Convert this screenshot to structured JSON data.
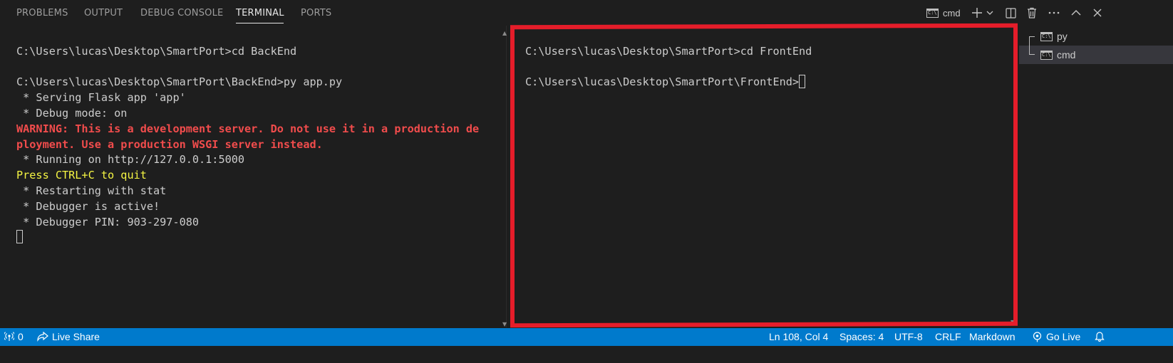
{
  "panel_tabs": [
    "PROBLEMS",
    "OUTPUT",
    "DEBUG CONSOLE",
    "TERMINAL",
    "PORTS"
  ],
  "active_tab": "TERMINAL",
  "toolbar": {
    "terminal_name": "cmd",
    "icons": [
      "cmd-icon",
      "plus-icon",
      "chevron-down-icon",
      "split-icon",
      "trash-icon",
      "more-icon",
      "chevron-up-icon",
      "close-icon"
    ]
  },
  "left_terminal": {
    "lines": [
      "",
      "C:\\Users\\lucas\\Desktop\\SmartPort>cd BackEnd",
      "",
      "C:\\Users\\lucas\\Desktop\\SmartPort\\BackEnd>py app.py",
      " * Serving Flask app 'app'",
      " * Debug mode: on",
      "WARNING: This is a development server. Do not use it in a production de",
      "ployment. Use a production WSGI server instead.",
      " * Running on http://127.0.0.1:5000",
      "Press CTRL+C to quit",
      " * Restarting with stat",
      " * Debugger is active!",
      " * Debugger PIN: 903-297-080"
    ],
    "line_colors": [
      "default",
      "default",
      "default",
      "default",
      "default",
      "default",
      "red",
      "red",
      "default",
      "yellow",
      "default",
      "default",
      "default"
    ]
  },
  "right_terminal": {
    "lines": [
      "",
      "C:\\Users\\lucas\\Desktop\\SmartPort>cd FrontEnd",
      "",
      "C:\\Users\\lucas\\Desktop\\SmartPort\\FrontEnd>"
    ]
  },
  "terminal_list": [
    {
      "label": "py",
      "selected": false
    },
    {
      "label": "cmd",
      "selected": true
    }
  ],
  "status_bar": {
    "remote": "0",
    "live_share": "Live Share",
    "position": "Ln 108, Col 4",
    "spaces": "Spaces: 4",
    "encoding": "UTF-8",
    "eol": "CRLF",
    "language": "Markdown",
    "go_live": "Go Live"
  },
  "colors": {
    "background": "#1e1e1e",
    "status_bar": "#007acc",
    "warning_red": "#f14c4c",
    "hint_yellow": "#f5f543",
    "highlight_border": "#e51d2a"
  }
}
